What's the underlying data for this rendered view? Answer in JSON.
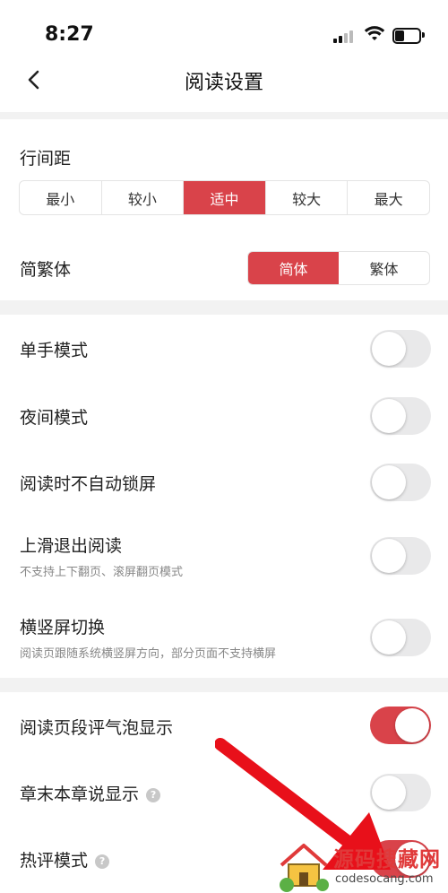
{
  "status": {
    "time": "8:27"
  },
  "header": {
    "title": "阅读设置"
  },
  "line_spacing": {
    "label": "行间距",
    "options": [
      "最小",
      "较小",
      "适中",
      "较大",
      "最大"
    ],
    "selected": "适中"
  },
  "script": {
    "label": "简繁体",
    "options": [
      "简体",
      "繁体"
    ],
    "selected": "简体"
  },
  "settings": [
    {
      "label": "单手模式",
      "subtitle": "",
      "enabled": false
    },
    {
      "label": "夜间模式",
      "subtitle": "",
      "enabled": false
    },
    {
      "label": "阅读时不自动锁屏",
      "subtitle": "",
      "enabled": false
    },
    {
      "label": "上滑退出阅读",
      "subtitle": "不支持上下翻页、滚屏翻页模式",
      "enabled": false
    },
    {
      "label": "横竖屏切换",
      "subtitle": "阅读页跟随系统横竖屏方向，部分页面不支持横屏",
      "enabled": false
    },
    {
      "label": "阅读页段评气泡显示",
      "subtitle": "",
      "enabled": true
    },
    {
      "label": "章末本章说显示",
      "subtitle": "",
      "enabled": false,
      "help": "?"
    },
    {
      "label": "热评模式",
      "subtitle": "",
      "enabled": true,
      "help": "?"
    }
  ],
  "watermark": {
    "title": "源码搜藏网",
    "url": "codesocang.com"
  },
  "colors": {
    "accent": "#d9434a",
    "divider": "#f2f2f2"
  }
}
